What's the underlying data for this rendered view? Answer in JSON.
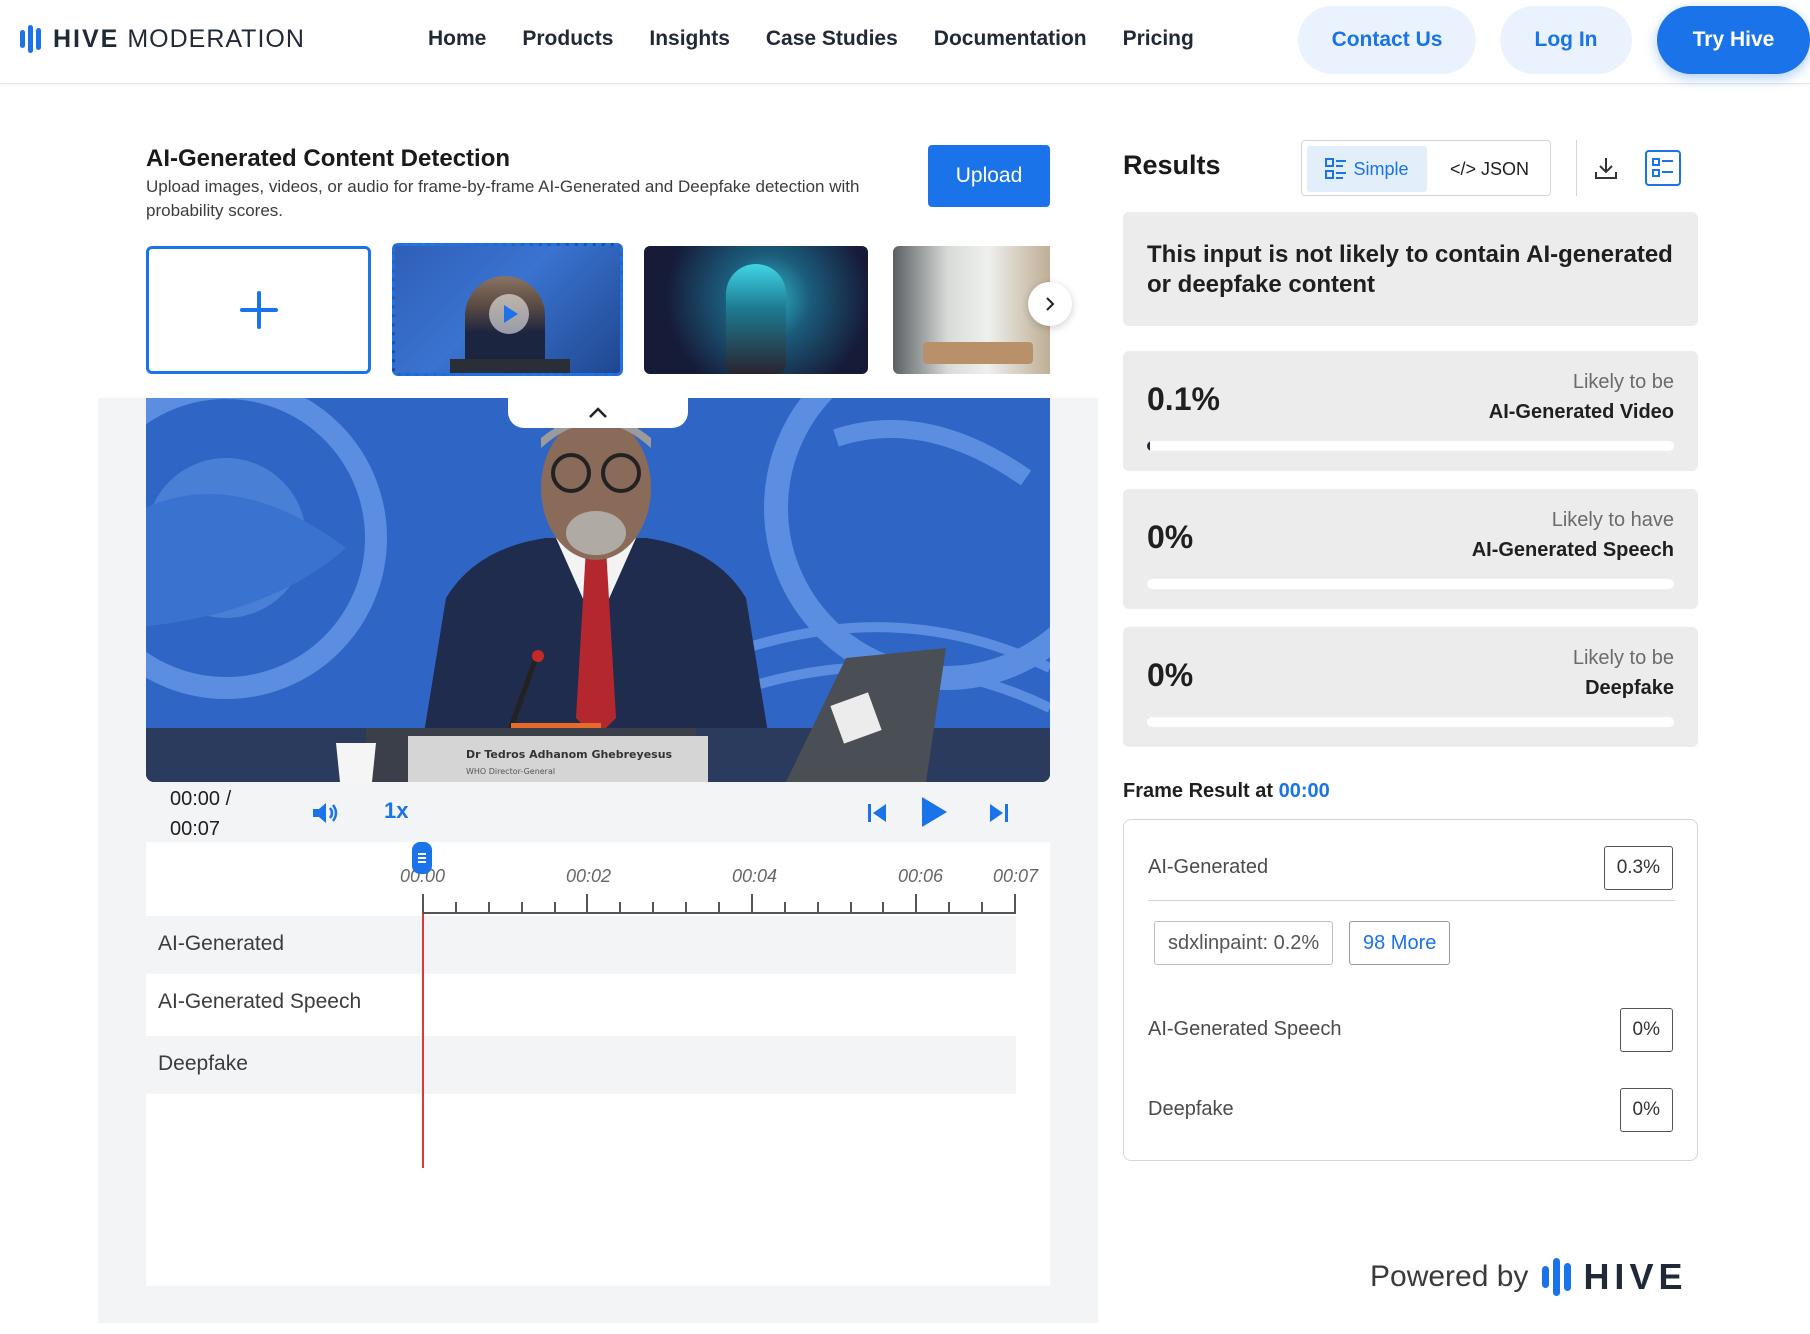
{
  "brand": {
    "logo_bold": "HIVE",
    "logo_rest": "MODERATION"
  },
  "nav": {
    "links": [
      "Home",
      "Products",
      "Insights",
      "Case Studies",
      "Documentation",
      "Pricing"
    ],
    "contact": "Contact Us",
    "login": "Log In",
    "try": "Try Hive"
  },
  "detector": {
    "title": "AI-Generated Content Detection",
    "subtitle": "Upload images, videos, or audio for frame-by-frame AI-Generated and Deepfake detection with probability scores.",
    "upload": "Upload"
  },
  "video": {
    "nameplate_name": "Dr Tedros Adhanom Ghebreyesus",
    "nameplate_title": "WHO Director-General"
  },
  "player": {
    "time_current": "00:00 /",
    "time_total": "00:07",
    "speed": "1x"
  },
  "timeline": {
    "ticks": [
      "00:00",
      "00:02",
      "00:04",
      "00:06",
      "00:07"
    ],
    "tracks": [
      "AI-Generated",
      "AI-Generated Speech",
      "Deepfake"
    ]
  },
  "results": {
    "title": "Results",
    "toggle_simple": "Simple",
    "toggle_json": "</> JSON",
    "summary_pre": "This input is ",
    "summary_bold": "not likely to contain AI-generated or deepfake content",
    "scores": [
      {
        "pct": "0.1%",
        "fraction": 0.001,
        "top": "Likely to be",
        "bottom": "AI-Generated Video"
      },
      {
        "pct": "0%",
        "fraction": 0,
        "top": "Likely to have",
        "bottom": "AI-Generated Speech"
      },
      {
        "pct": "0%",
        "fraction": 0,
        "top": "Likely to be",
        "bottom": "Deepfake"
      }
    ],
    "frame_label": "Frame Result at ",
    "frame_time": "00:00",
    "frame_rows": [
      {
        "label": "AI-Generated",
        "value": "0.3%"
      },
      {
        "label": "AI-Generated Speech",
        "value": "0%"
      },
      {
        "label": "Deepfake",
        "value": "0%"
      }
    ],
    "chips": {
      "top_model": "sdxlinpaint: 0.2%",
      "more": "98 More"
    }
  },
  "footer": {
    "powered_by": "Powered by",
    "brand": "HIVE"
  },
  "colors": {
    "accent": "#1a73e8",
    "playhead": "#d63a3a"
  }
}
